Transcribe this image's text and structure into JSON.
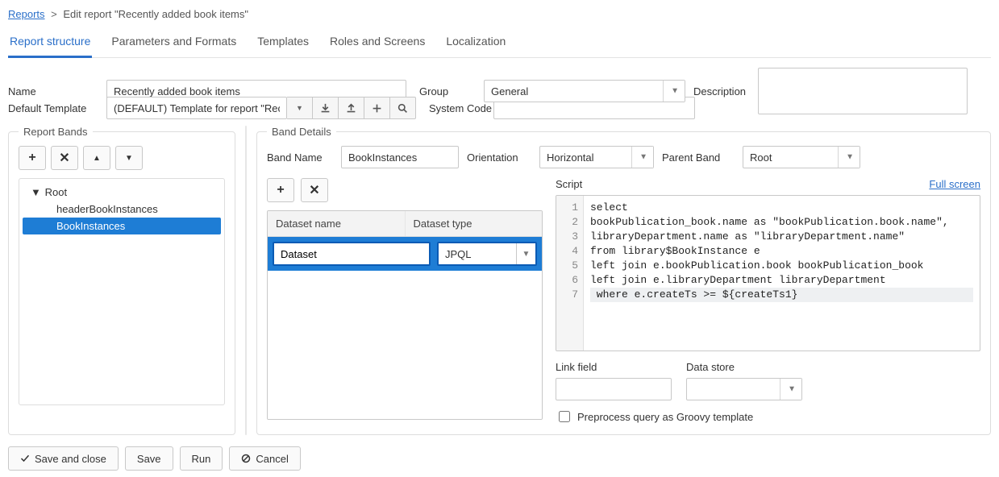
{
  "breadcrumb": {
    "root": "Reports",
    "current": "Edit report \"Recently added book items\""
  },
  "tabs": [
    "Report structure",
    "Parameters and Formats",
    "Templates",
    "Roles and Screens",
    "Localization"
  ],
  "activeTab": 0,
  "form": {
    "name_label": "Name",
    "name_value": "Recently added book items",
    "group_label": "Group",
    "group_value": "General",
    "description_label": "Description",
    "description_value": "",
    "default_template_label": "Default Template",
    "default_template_value": "(DEFAULT) Template for report \"Recently added book items\"",
    "system_code_label": "System Code",
    "system_code_value": ""
  },
  "leftPanel": {
    "legend": "Report Bands",
    "tree": {
      "root": "Root",
      "children": [
        "headerBookInstances",
        "BookInstances"
      ],
      "selectedIndex": 1
    }
  },
  "rightPanel": {
    "legend": "Band Details",
    "band_name_label": "Band Name",
    "band_name_value": "BookInstances",
    "orientation_label": "Orientation",
    "orientation_value": "Horizontal",
    "parent_label": "Parent Band",
    "parent_value": "Root",
    "dataset": {
      "col_name": "Dataset name",
      "col_type": "Dataset type",
      "row_name": "Dataset",
      "row_type": "JPQL"
    },
    "script_label": "Script",
    "full_screen": "Full screen",
    "script_lines": [
      "select",
      "bookPublication_book.name as \"bookPublication.book.name\",",
      "libraryDepartment.name as \"libraryDepartment.name\"",
      "from library$BookInstance e",
      "left join e.bookPublication.book bookPublication_book",
      "left join e.libraryDepartment libraryDepartment",
      " where e.createTs >= ${createTs1}"
    ],
    "highlight_line": 7,
    "link_field_label": "Link field",
    "link_field_value": "",
    "data_store_label": "Data store",
    "data_store_value": "",
    "preprocess_label": "Preprocess query as Groovy template",
    "preprocess_checked": false
  },
  "footer": {
    "save_close": "Save and close",
    "save": "Save",
    "run": "Run",
    "cancel": "Cancel"
  },
  "icons": {
    "plus": "+",
    "times": "✕",
    "up": "▲",
    "down": "▼"
  }
}
